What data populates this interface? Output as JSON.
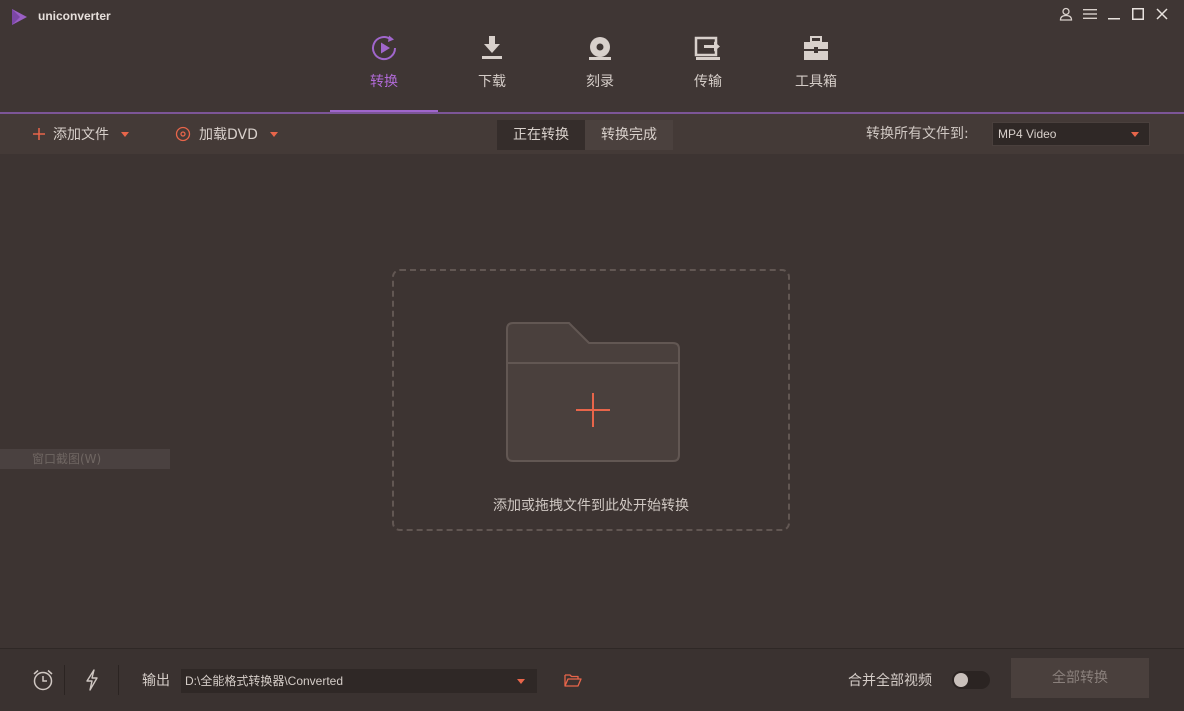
{
  "app": {
    "name": "uniconverter"
  },
  "nav": {
    "items": [
      {
        "label": "转换",
        "icon": "convert-icon",
        "active": true
      },
      {
        "label": "下载",
        "icon": "download-icon",
        "active": false
      },
      {
        "label": "刻录",
        "icon": "burn-disc-icon",
        "active": false
      },
      {
        "label": "传输",
        "icon": "transfer-icon",
        "active": false
      },
      {
        "label": "工具箱",
        "icon": "toolbox-icon",
        "active": false
      }
    ]
  },
  "toolbar": {
    "add_files": "添加文件",
    "load_dvd": "加载DVD",
    "tabs": [
      {
        "label": "正在转换",
        "active": true
      },
      {
        "label": "转换完成",
        "active": false
      }
    ],
    "convert_all_to_label": "转换所有文件到:",
    "format_value": "MP4 Video"
  },
  "main": {
    "drop_text": "添加或拖拽文件到此处开始转换",
    "ghost_tip": "窗口截图(W)"
  },
  "bottom": {
    "output_label": "输出",
    "output_path": "D:\\全能格式转换器\\Converted",
    "merge_label": "合并全部视频",
    "merge_on": false,
    "convert_all_button": "全部转换"
  },
  "colors": {
    "accent_purple": "#a066cc",
    "accent_orange": "#e8654a",
    "background": "#3d3432"
  }
}
